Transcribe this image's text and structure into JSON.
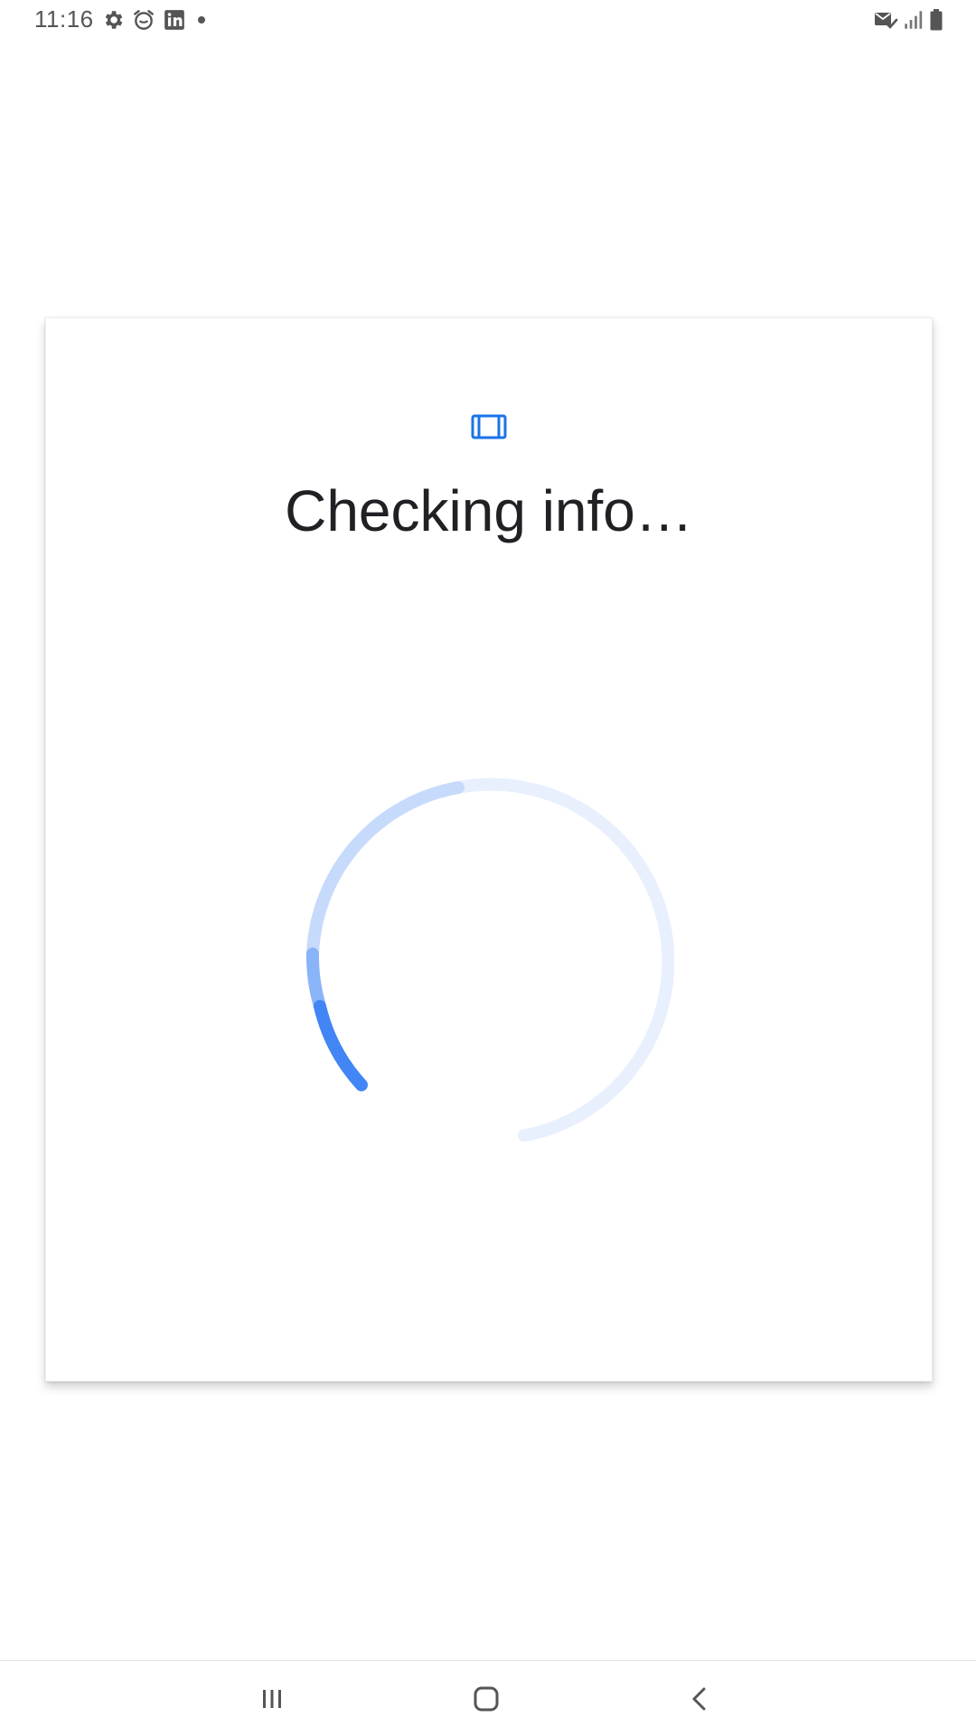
{
  "status_bar": {
    "time": "11:16",
    "left_icons": [
      "settings-icon",
      "alarm-icon",
      "linkedin-icon",
      "more-notifications-dot-icon"
    ],
    "right_icons": [
      "mail-check-icon",
      "signal-icon",
      "battery-icon"
    ]
  },
  "card": {
    "icon": "card-frame-icon",
    "title": "Checking info…",
    "spinner": {
      "state": "loading",
      "indeterminate": true
    }
  },
  "nav_bar": {
    "buttons": [
      "recent-apps-icon",
      "home-icon",
      "back-icon"
    ]
  },
  "colors": {
    "accent": "#4285f4",
    "spinner_track": "#e8f0fe",
    "spinner_trail": "#c6dafc",
    "title_text": "#202124",
    "status_text": "#555555"
  }
}
